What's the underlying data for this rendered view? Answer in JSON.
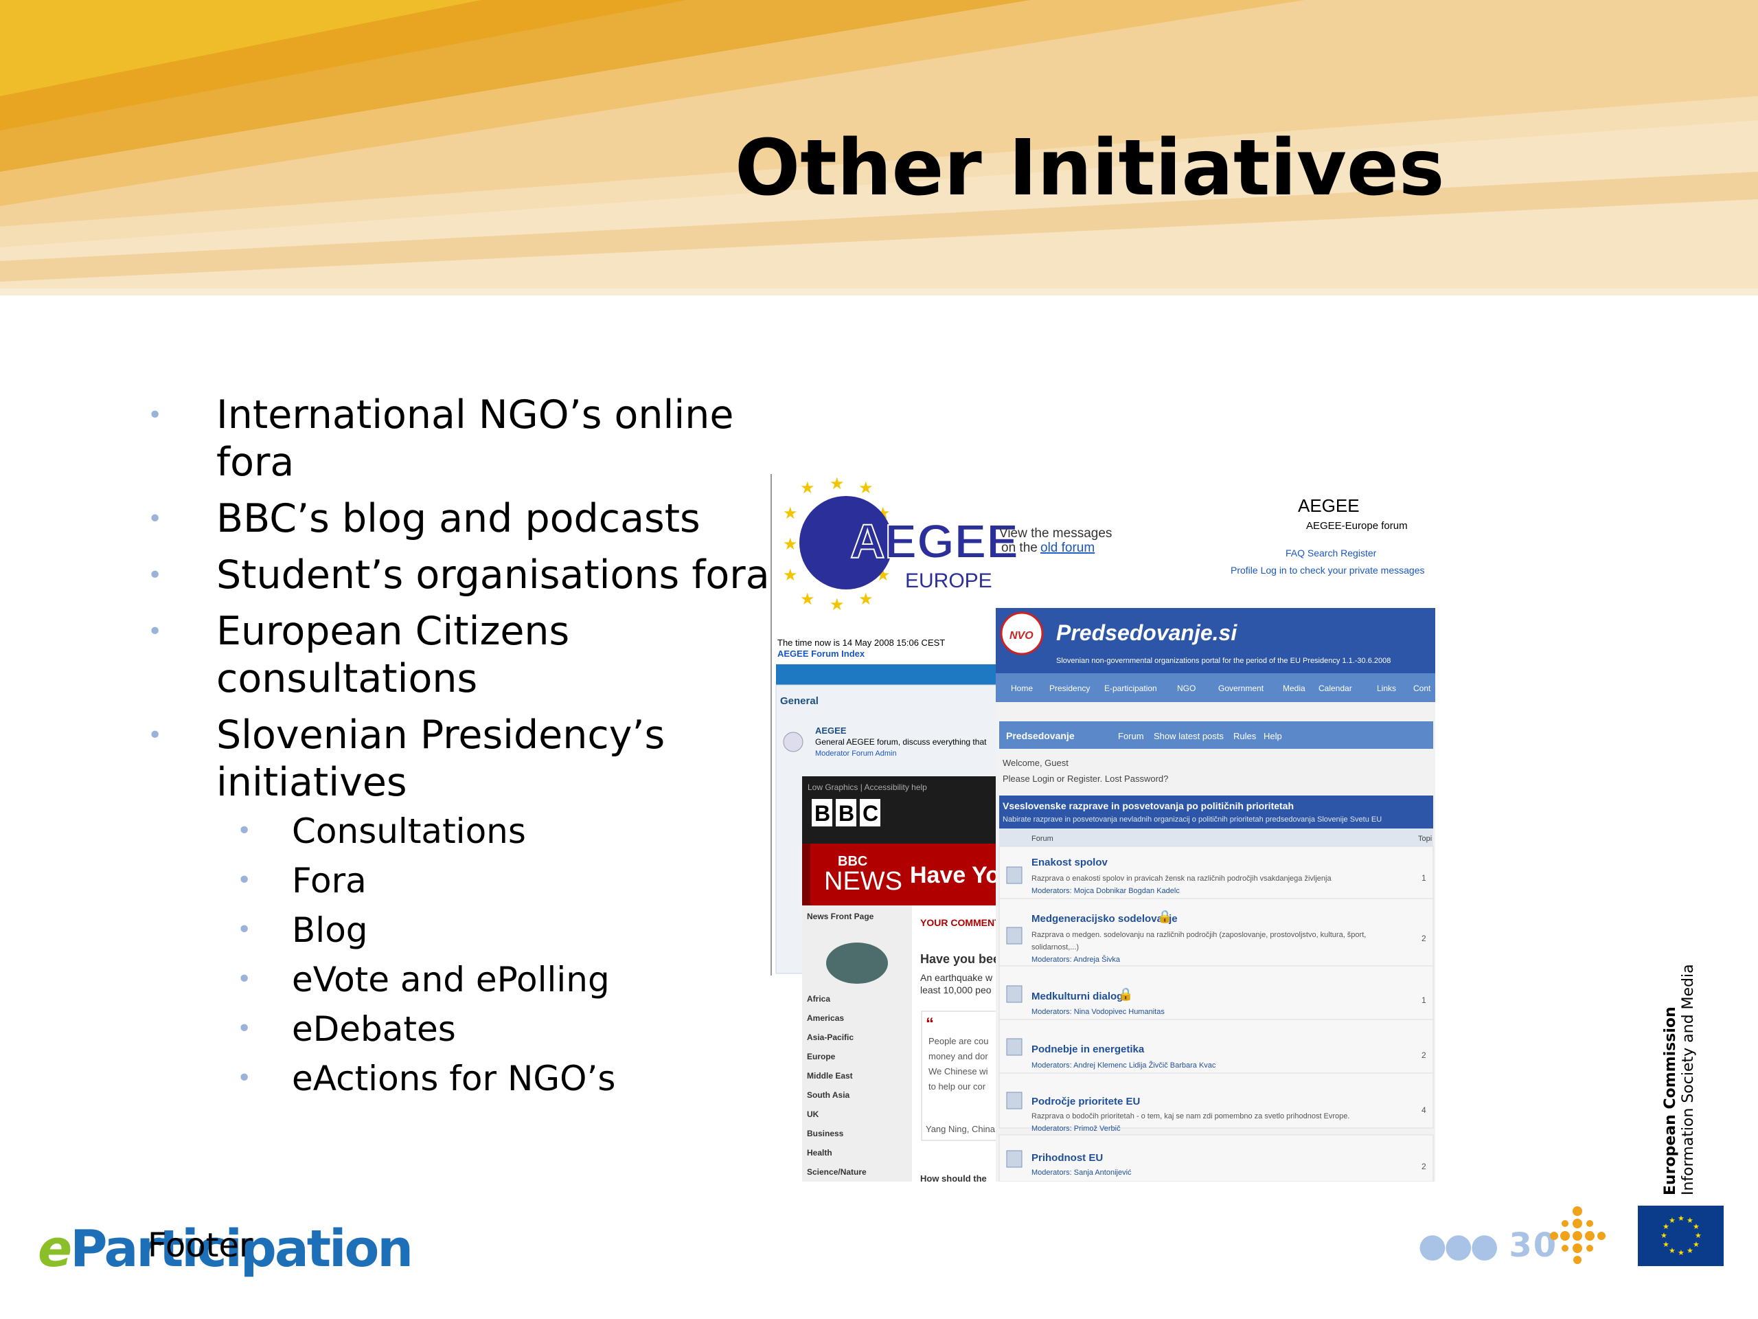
{
  "title": "Other Initiatives",
  "bullets": [
    {
      "text": "International NGO’s online fora"
    },
    {
      "text": "BBC’s blog and podcasts"
    },
    {
      "text": "Student’s organisations fora"
    },
    {
      "text": "European Citizens consultations"
    },
    {
      "text": "Slovenian Presidency’s initiatives"
    }
  ],
  "subbullets": [
    "Consultations",
    "Fora",
    "Blog",
    "eVote and ePolling",
    "eDebates",
    "eActions for NGO’s"
  ],
  "screenshots": {
    "aegee": {
      "logo_text": "AEGEE",
      "logo_sub": "EUROPE",
      "view_msg_1": "View the messages",
      "view_msg_2": "on the",
      "old_forum": "old forum",
      "heading": "AEGEE",
      "subheading": "AEGEE-Europe forum",
      "links": "FAQ  Search  Register",
      "links2": "Profile  Log in to check your private messages",
      "time": "The time now is 14 May 2008 15:06 CEST",
      "index": "AEGEE Forum Index",
      "section": "General",
      "row_title": "AEGEE",
      "row_desc": "General AEGEE forum, discuss everything that",
      "row_mod": "Moderator Forum Admin"
    },
    "bbc": {
      "top": "Low Graphics | Accessibility help",
      "logo": "BBC",
      "news": "NEWS",
      "have_you": "Have You",
      "nav": [
        "News Front Page",
        "Africa",
        "Americas",
        "Asia-Pacific",
        "Europe",
        "Middle East",
        "South Asia",
        "UK",
        "Business",
        "Health",
        "Science/Nature"
      ],
      "comment_head": "YOUR COMMENT",
      "q": "Have you bee",
      "p1": "An earthquake w",
      "p2": "least 10,000 peo",
      "quote": "People are cou",
      "quote2": "money and dor",
      "quote3": "We Chinese wi",
      "quote4": "to help our cor",
      "author": "Yang Ning, China",
      "more": "How should the"
    },
    "presid": {
      "nvo": "NVO",
      "title": "Predsedovanje.si",
      "tagline": "Slovenian non-governmental organizations portal for the period of the EU Presidency 1.1.-30.6.2008",
      "nav": [
        "Home",
        "Presidency",
        "E-participation",
        "NGO",
        "Government",
        "Media",
        "Calendar",
        "Links",
        "Cont"
      ],
      "bar": "Predsedovanje",
      "bar_links": [
        "Forum",
        "Show latest posts",
        "Rules",
        "Help"
      ],
      "welcome": "Welcome, Guest",
      "login": "Please Login or Register.   Lost Password?",
      "sec_title": "Vseslovenske razprave in posvetovanja po političnih prioritetah",
      "sec_desc": "Nabirate razprave in posvetovanja nevladnih organizacij o političnih prioritetah predsedovanja Slovenije Svetu EU",
      "col_forum": "Forum",
      "col_topics": "Topi",
      "rows": [
        {
          "t": "Enakost spolov",
          "d": "Razprava o enakosti spolov in pravicah žensk na različnih področjih vsakdanjega življenja",
          "m": "Moderators:  Mojca Dobnikar  Bogdan Kadelc",
          "n": "1"
        },
        {
          "t": "Medgeneracijsko sodelovanje",
          "d": "Razprava o medgen. sodelovanju na različnih področjih (zaposlovanje, prostovoljstvo, kultura, šport,",
          "d2": "solidarnost,...)",
          "m": "Moderators:  Andreja Šivka",
          "n": "2"
        },
        {
          "t": "Medkulturni dialog",
          "d": "",
          "m": "Moderators:  Nina Vodopivec  Humanitas",
          "n": "1"
        },
        {
          "t": "Podnebje in energetika",
          "d": "",
          "m": "Moderators:  Andrej Klemenc  Lidija Živčič  Barbara Kvac",
          "n": "2"
        },
        {
          "t": "Področje prioritete EU",
          "d": "Razprava o bodočih prioritetah - o tem, kaj se nam zdi pomembno za svetlo prihodnost Evrope.",
          "m": "Moderators:  Primož Verbič",
          "n": "4"
        },
        {
          "t": "Prihodnost EU",
          "d": "",
          "m": "Moderators:  Sanja Antonijević",
          "n": "2"
        }
      ]
    }
  },
  "footer": "Footer",
  "logo": {
    "e": "e",
    "rest": "Participation"
  },
  "page_number": "30",
  "ec": {
    "line1": "European Commission",
    "line2": "Information Society and Media"
  },
  "colors": {
    "bullet": "#9bb3d9",
    "accent_blue": "#1d6fb8",
    "eu_blue": "#0b3c8c",
    "header_gold": "#e7a722"
  }
}
